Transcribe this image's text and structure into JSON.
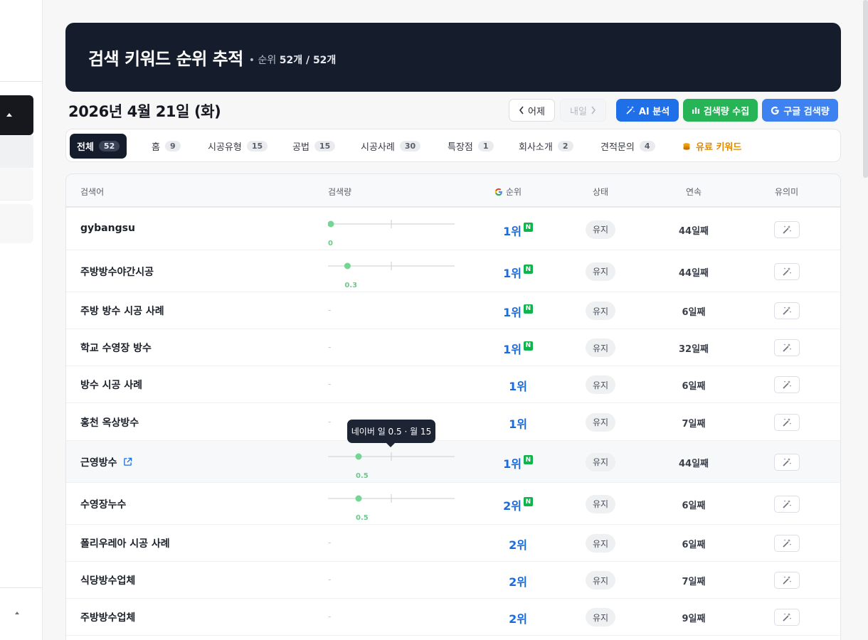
{
  "header": {
    "title": "검색 키워드 순위 추적",
    "sub_prefix": "• 순위",
    "sub_count": "52개 / 52개"
  },
  "date": "2026년 4월 21일 (화)",
  "buttons": {
    "prev": "어제",
    "next": "내일",
    "ai": "AI 분석",
    "volume": "검색량 수집",
    "google": "구글 검색량"
  },
  "tabs": [
    {
      "label": "전체",
      "count": "52"
    },
    {
      "label": "홈",
      "count": "9"
    },
    {
      "label": "시공유형",
      "count": "15"
    },
    {
      "label": "공법",
      "count": "15"
    },
    {
      "label": "시공사례",
      "count": "30"
    },
    {
      "label": "특장점",
      "count": "1"
    },
    {
      "label": "회사소개",
      "count": "2"
    },
    {
      "label": "견적문의",
      "count": "4"
    },
    {
      "label": "유료 키워드",
      "count": ""
    }
  ],
  "table": {
    "headers": {
      "keyword": "검색어",
      "volume": "검색량",
      "rank": "순위",
      "status": "상태",
      "streak": "연속",
      "signif": "유의미"
    },
    "rows": [
      {
        "keyword": "gybangsu",
        "volume": "0",
        "spark": 0,
        "rank": "1위",
        "naver": true,
        "status": "유지",
        "streak": "44일째"
      },
      {
        "keyword": "주방방수야간시공",
        "volume": "0.3",
        "spark": 0.3,
        "rank": "1위",
        "naver": true,
        "status": "유지",
        "streak": "44일째"
      },
      {
        "keyword": "주방 방수 시공 사례",
        "volume": "-",
        "rank": "1위",
        "naver": true,
        "status": "유지",
        "streak": "6일째"
      },
      {
        "keyword": "학교 수영장 방수",
        "volume": "-",
        "rank": "1위",
        "naver": true,
        "status": "유지",
        "streak": "32일째"
      },
      {
        "keyword": "방수 시공 사례",
        "volume": "-",
        "rank": "1위",
        "naver": false,
        "status": "유지",
        "streak": "6일째"
      },
      {
        "keyword": "홍천 옥상방수",
        "volume": "-",
        "rank": "1위",
        "naver": false,
        "status": "유지",
        "streak": "7일째"
      },
      {
        "keyword": "근영방수",
        "volume": "0.5",
        "spark": 0.5,
        "rank": "1위",
        "naver": true,
        "status": "유지",
        "streak": "44일째"
      },
      {
        "keyword": "수영장누수",
        "volume": "0.5",
        "spark": 0.5,
        "rank": "2위",
        "naver": true,
        "status": "유지",
        "streak": "6일째"
      },
      {
        "keyword": "폴리우레아 시공 사례",
        "volume": "-",
        "rank": "2위",
        "naver": false,
        "status": "유지",
        "streak": "6일째"
      },
      {
        "keyword": "식당방수업체",
        "volume": "-",
        "rank": "2위",
        "naver": false,
        "status": "유지",
        "streak": "7일째"
      },
      {
        "keyword": "주방방수업체",
        "volume": "-",
        "rank": "2위",
        "naver": false,
        "status": "유지",
        "streak": "9일째"
      }
    ]
  },
  "tooltip": "네이버 일 0.5 · 월 15",
  "colors": {
    "banner": "#151c2c",
    "rank_blue": "#1a6bdc",
    "naver_green": "#11b34c",
    "ai_button": "#1f6fe8",
    "volume_button": "#27b456",
    "google_button": "#3d82f0",
    "paid_orange": "#e08a00"
  }
}
